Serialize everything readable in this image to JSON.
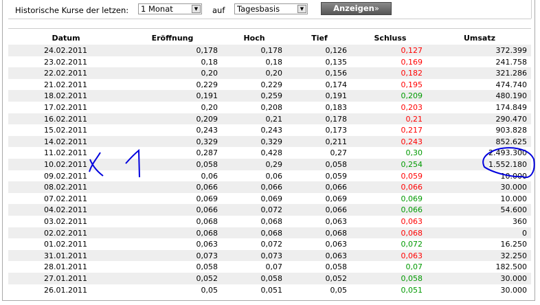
{
  "controls": {
    "label": "Historische Kurse der letzen:",
    "period": "1 Monat",
    "auf": "auf",
    "basis": "Tagesbasis",
    "button": "Anzeigen",
    "button_icon": "double-chevron-right-icon"
  },
  "colors": {
    "down": "#ff0000",
    "up": "#009900",
    "annotation": "#0000dd"
  },
  "columns": [
    "Datum",
    "Eröffnung",
    "Hoch",
    "Tief",
    "Schluss",
    "Umsatz"
  ],
  "rows": [
    [
      "24.02.2011",
      "0,178",
      "0,178",
      "0,126",
      "0,127",
      "372.399",
      "down"
    ],
    [
      "23.02.2011",
      "0,18",
      "0,18",
      "0,135",
      "0,169",
      "241.758",
      "down"
    ],
    [
      "22.02.2011",
      "0,20",
      "0,20",
      "0,156",
      "0,182",
      "321.286",
      "down"
    ],
    [
      "21.02.2011",
      "0,229",
      "0,229",
      "0,174",
      "0,195",
      "474.740",
      "down"
    ],
    [
      "18.02.2011",
      "0,191",
      "0,259",
      "0,191",
      "0,209",
      "480.190",
      "up"
    ],
    [
      "17.02.2011",
      "0,20",
      "0,208",
      "0,183",
      "0,203",
      "174.849",
      "down"
    ],
    [
      "16.02.2011",
      "0,209",
      "0,21",
      "0,178",
      "0,21",
      "290.470",
      "down"
    ],
    [
      "15.02.2011",
      "0,243",
      "0,243",
      "0,173",
      "0,217",
      "903.828",
      "down"
    ],
    [
      "14.02.2011",
      "0,329",
      "0,329",
      "0,211",
      "0,243",
      "852.625",
      "down"
    ],
    [
      "11.02.2011",
      "0,287",
      "0,428",
      "0,27",
      "0,30",
      "2.493.300",
      "up"
    ],
    [
      "10.02.2011",
      "0,058",
      "0,29",
      "0,058",
      "0,254",
      "1.552.180",
      "up"
    ],
    [
      "09.02.2011",
      "0,06",
      "0,06",
      "0,059",
      "0,059",
      "10.000",
      "down"
    ],
    [
      "08.02.2011",
      "0,066",
      "0,066",
      "0,066",
      "0,066",
      "30.000",
      "down"
    ],
    [
      "07.02.2011",
      "0,069",
      "0,069",
      "0,069",
      "0,069",
      "10.000",
      "up"
    ],
    [
      "04.02.2011",
      "0,066",
      "0,072",
      "0,066",
      "0,066",
      "54.600",
      "up"
    ],
    [
      "03.02.2011",
      "0,068",
      "0,068",
      "0,063",
      "0,063",
      "360",
      "down"
    ],
    [
      "02.02.2011",
      "0,068",
      "0,068",
      "0,068",
      "0,068",
      "0",
      "down"
    ],
    [
      "01.02.2011",
      "0,063",
      "0,072",
      "0,063",
      "0,072",
      "16.250",
      "up"
    ],
    [
      "31.01.2011",
      "0,073",
      "0,073",
      "0,063",
      "0,063",
      "32.250",
      "down"
    ],
    [
      "28.01.2011",
      "0,058",
      "0,07",
      "0,058",
      "0,07",
      "182.500",
      "up"
    ],
    [
      "27.01.2011",
      "0,052",
      "0,058",
      "0,052",
      "0,058",
      "30.000",
      "up"
    ],
    [
      "26.01.2011",
      "0,05",
      "0,051",
      "0,05",
      "0,051",
      "30.000",
      "up"
    ]
  ],
  "annotation": {
    "handwritten": "X 1"
  }
}
